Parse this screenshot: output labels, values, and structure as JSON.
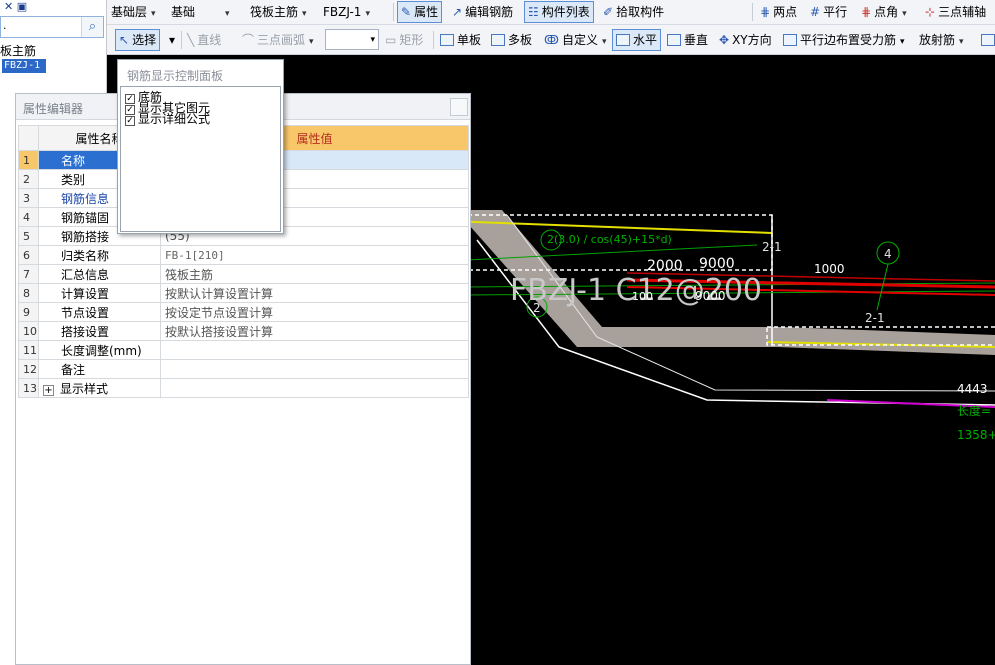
{
  "left_panel": {
    "search_value": ".",
    "tree_parent": "板主筋",
    "tree_child": "FBZJ-1"
  },
  "toolbar1": {
    "floor": "基础层",
    "category": "基础",
    "type": "筏板主筋",
    "element": "FBZJ-1",
    "property_btn": "属性",
    "edit_rebar_btn": "编辑钢筋",
    "component_list_btn": "构件列表",
    "pick_component_btn": "拾取构件",
    "two_point_btn": "两点",
    "parallel_btn": "平行",
    "point_angle_btn": "点角",
    "three_point_aux_btn": "三点辅轴"
  },
  "toolbar2": {
    "select_btn": "选择",
    "line_btn": "直线",
    "arc_btn": "三点画弧",
    "rect_btn": "矩形",
    "single_slab_btn": "单板",
    "multi_slab_btn": "多板",
    "custom_btn": "自定义",
    "horizontal_btn": "水平",
    "vertical_btn": "垂直",
    "xy_btn": "XY方向",
    "parallel_edge_btn": "平行边布置受力筋",
    "radial_btn": "放射筋"
  },
  "rebar_panel": {
    "title": "钢筋显示控制面板",
    "options": [
      {
        "label": "底筋",
        "checked": true
      },
      {
        "label": "显示其它图元",
        "checked": true
      },
      {
        "label": "显示详细公式",
        "checked": true
      }
    ]
  },
  "prop_editor": {
    "title": "属性编辑器",
    "col_name": "属性名称",
    "col_value": "属性值",
    "rows": [
      {
        "num": "1",
        "name": "名称",
        "value": "",
        "selected": true
      },
      {
        "num": "2",
        "name": "类别",
        "value": ""
      },
      {
        "num": "3",
        "name": "钢筋信息",
        "value": "",
        "blue": true
      },
      {
        "num": "4",
        "name": "钢筋锚固",
        "value": ""
      },
      {
        "num": "5",
        "name": "钢筋搭接",
        "value": "(55)"
      },
      {
        "num": "6",
        "name": "归类名称",
        "value": "FB-1[210]",
        "mono": true
      },
      {
        "num": "7",
        "name": "汇总信息",
        "value": "筏板主筋"
      },
      {
        "num": "8",
        "name": "计算设置",
        "value": "按默认计算设置计算"
      },
      {
        "num": "9",
        "name": "节点设置",
        "value": "按设定节点设置计算"
      },
      {
        "num": "10",
        "name": "搭接设置",
        "value": "按默认搭接设置计算"
      },
      {
        "num": "11",
        "name": "长度调整(mm)",
        "value": ""
      },
      {
        "num": "12",
        "name": "备注",
        "value": ""
      },
      {
        "num": "13",
        "name": "显示样式",
        "value": "",
        "expandable": true
      }
    ]
  },
  "canvas": {
    "label_main": "FBZJ-1 C12@200",
    "label_2000": "2000",
    "label_9000a": "9000",
    "label_9000b": "9000",
    "label_1000": "1000",
    "label_100": "100",
    "label_formula": "2(3.0) / cos(45)+15*d)",
    "label_2_1a": "2-1",
    "label_2_1b": "2-1",
    "label_4": "4",
    "label_2": "2",
    "label_4443": "4443",
    "label_len": "长度=",
    "label_1358": "1358+"
  }
}
